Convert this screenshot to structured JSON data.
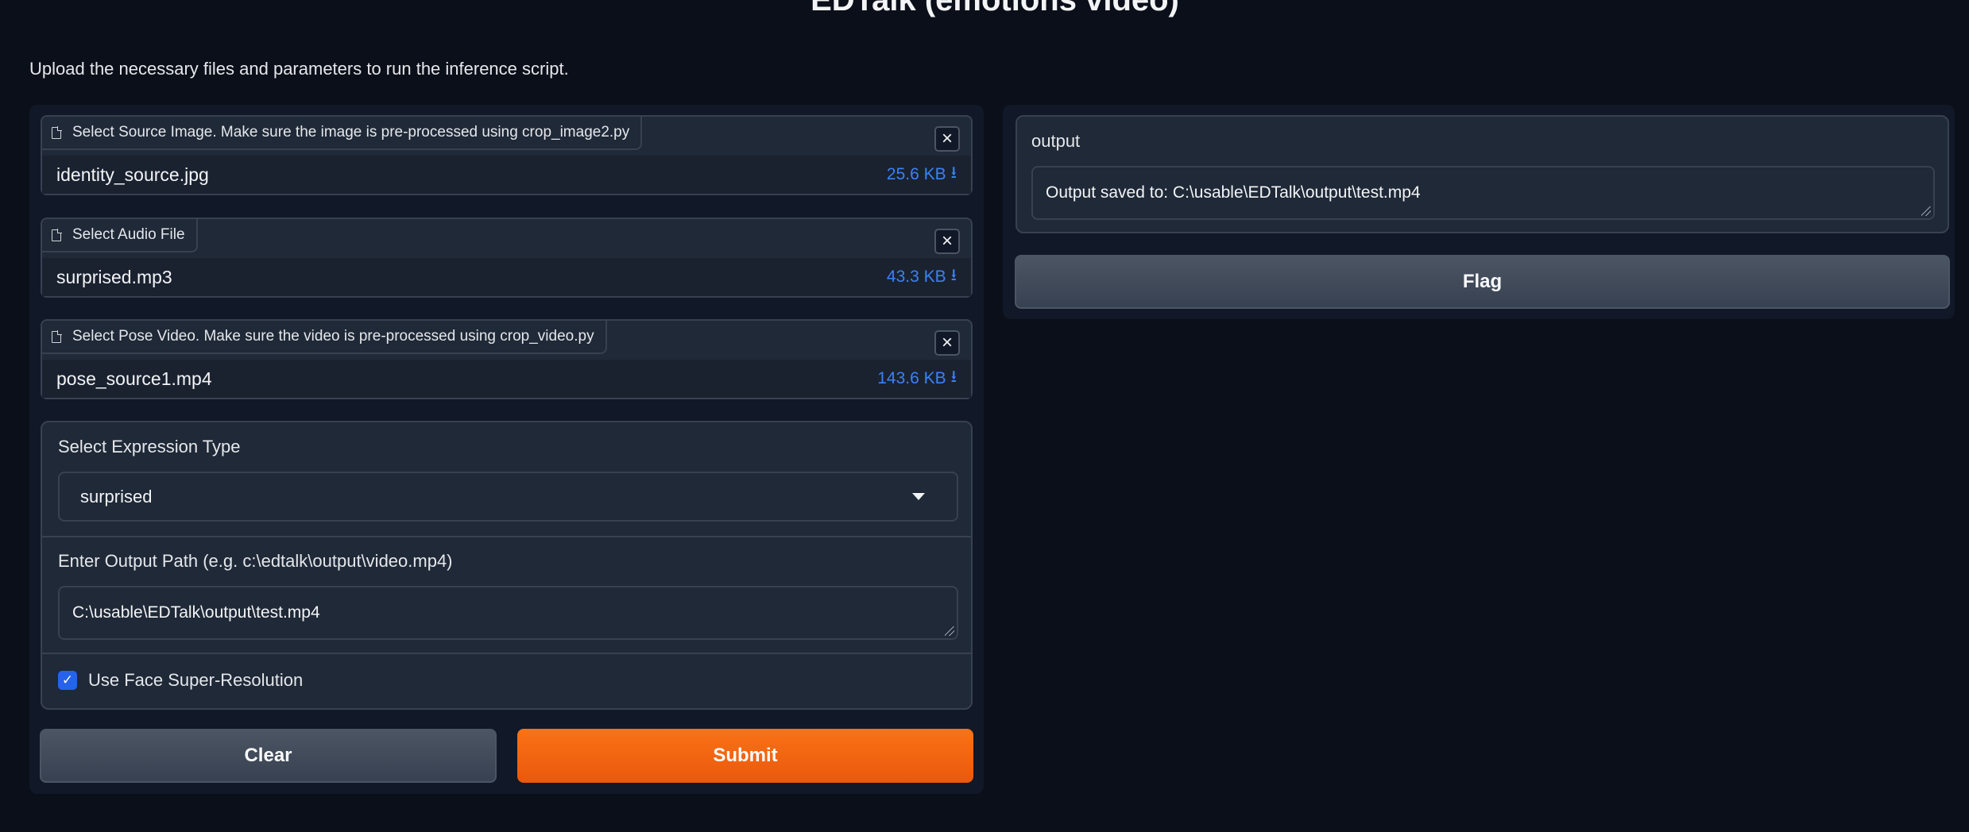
{
  "header": {
    "title": "EDTalk (emotions video)",
    "description": "Upload the necessary files and parameters to run the inference script."
  },
  "inputs": {
    "files": [
      {
        "label": "Select Source Image. Make sure the image is pre-processed using crop_image2.py",
        "filename": "identity_source.jpg",
        "size": "25.6 KB"
      },
      {
        "label": "Select Audio File",
        "filename": "surprised.mp3",
        "size": "43.3 KB"
      },
      {
        "label": "Select Pose Video. Make sure the video is pre-processed using crop_video.py",
        "filename": "pose_source1.mp4",
        "size": "143.6 KB"
      }
    ],
    "expression": {
      "label": "Select Expression Type",
      "value": "surprised"
    },
    "output_path": {
      "label": "Enter Output Path (e.g. c:\\edtalk\\output\\video.mp4)",
      "value": "C:\\usable\\EDTalk\\output\\test.mp4"
    },
    "super_resolution": {
      "label": "Use Face Super-Resolution",
      "checked": true
    }
  },
  "actions": {
    "clear_label": "Clear",
    "submit_label": "Submit",
    "flag_label": "Flag"
  },
  "output": {
    "label": "output",
    "value": "Output saved to: C:\\usable\\EDTalk\\output\\test.mp4"
  },
  "icons": {
    "file": "file-icon",
    "close": "close-icon",
    "download": "download-icon",
    "dropdown": "chevron-down-icon",
    "check": "check-icon"
  },
  "colors": {
    "background": "#0b0f19",
    "primary": "#f97316",
    "link": "#3b82f6",
    "checkbox": "#2563eb"
  }
}
